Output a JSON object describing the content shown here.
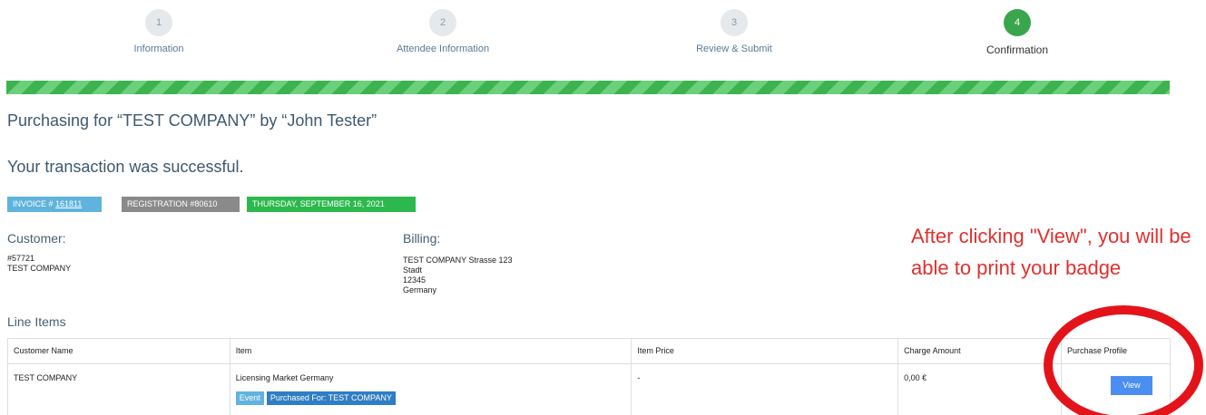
{
  "steps": [
    {
      "number": "1",
      "label": "Information"
    },
    {
      "number": "2",
      "label": "Attendee Information"
    },
    {
      "number": "3",
      "label": "Review & Submit"
    },
    {
      "number": "4",
      "label": "Confirmation"
    }
  ],
  "progress": {
    "percent": 100,
    "color": "#3db34f"
  },
  "purchasing_text": "Purchasing for “TEST COMPANY” by “John Tester”",
  "success_text": "Your transaction was successful.",
  "badges": {
    "invoice_prefix": "INVOICE # ",
    "invoice_number": "161811",
    "registration": "REGISTRATION #80610",
    "date": "THURSDAY, SEPTEMBER 16, 2021"
  },
  "customer": {
    "heading": "Customer:",
    "id": "#57721",
    "name": "TEST COMPANY"
  },
  "billing": {
    "heading": "Billing:",
    "line1": "TEST COMPANY Strasse 123",
    "line2": "Stadt",
    "line3": "12345",
    "line4": "Germany"
  },
  "annotation": "After clicking \"View\", you will be able to print your badge",
  "line_items": {
    "heading": "Line Items",
    "columns": [
      "Customer Name",
      "Item",
      "Item Price",
      "Charge Amount",
      "Purchase Profile"
    ],
    "rows": [
      {
        "customer_name": "TEST COMPANY",
        "item": "Licensing Market Germany",
        "tag_event": "Event",
        "tag_purchased": "Purchased For: TEST COMPANY",
        "item_price": "-",
        "charge_amount": "0,00 €",
        "action": "View"
      }
    ]
  },
  "colors": {
    "step_active": "#3aa64c",
    "annotation_red": "#e0312e",
    "view_button": "#4b8ef1"
  }
}
